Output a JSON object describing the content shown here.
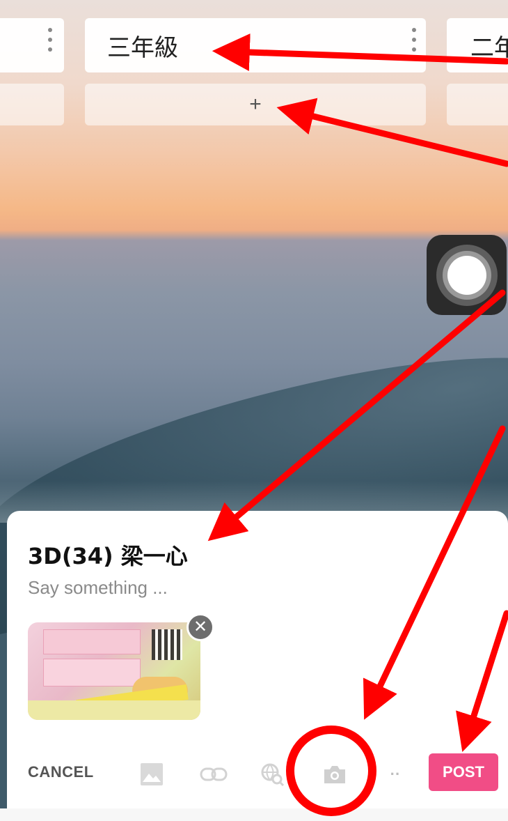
{
  "columns": [
    {
      "title": "",
      "add_label": ""
    },
    {
      "title": "三年級",
      "add_label": "+"
    },
    {
      "title": "二年",
      "add_label": ""
    }
  ],
  "composer": {
    "author": "3D(34) 梁一心",
    "placeholder": "Say something ...",
    "remove_label": "✕",
    "cancel_label": "CANCEL",
    "post_label": "POST",
    "more_label": "··",
    "toolbar_icons": [
      "image-icon",
      "link-icon",
      "web-search-icon",
      "camera-icon",
      "more-icon"
    ]
  },
  "colors": {
    "post_button": "#f14d86",
    "annotation": "#ff0000"
  }
}
